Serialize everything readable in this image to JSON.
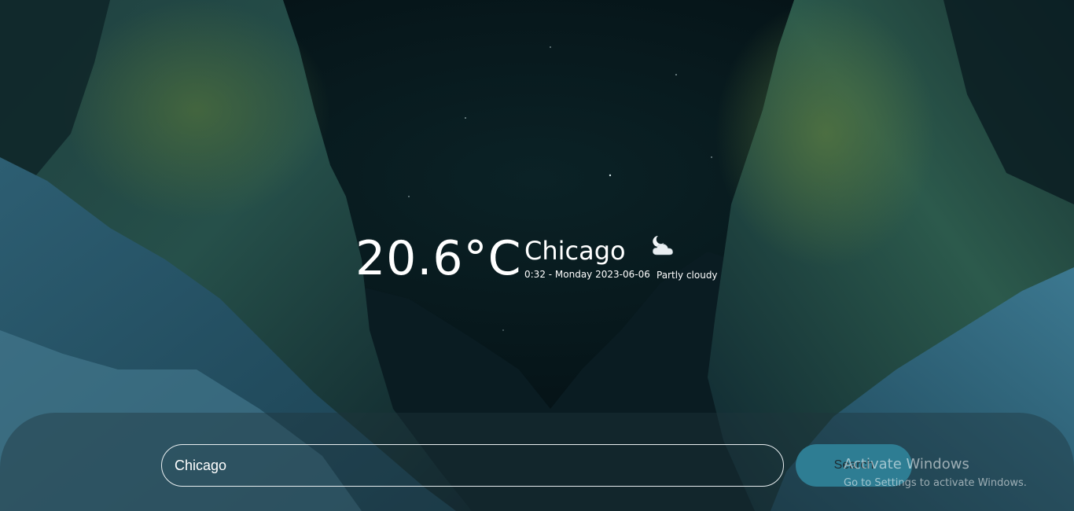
{
  "weather": {
    "temperature": "20.6°C",
    "city": "Chicago",
    "datetime": "0:32 - Monday 2023-06-06",
    "condition": "Partly cloudy",
    "condition_icon": "partly-cloudy-night-icon"
  },
  "search": {
    "value": "Chicago",
    "button_label": "Search",
    "accent_color": "#2e7d93"
  },
  "watermark": {
    "title": "Activate Windows",
    "subtitle": "Go to Settings to activate Windows."
  },
  "background": {
    "sky_color": "#06171c",
    "rock_color": "#1d3a40",
    "snow_color": "#3a6f84"
  }
}
